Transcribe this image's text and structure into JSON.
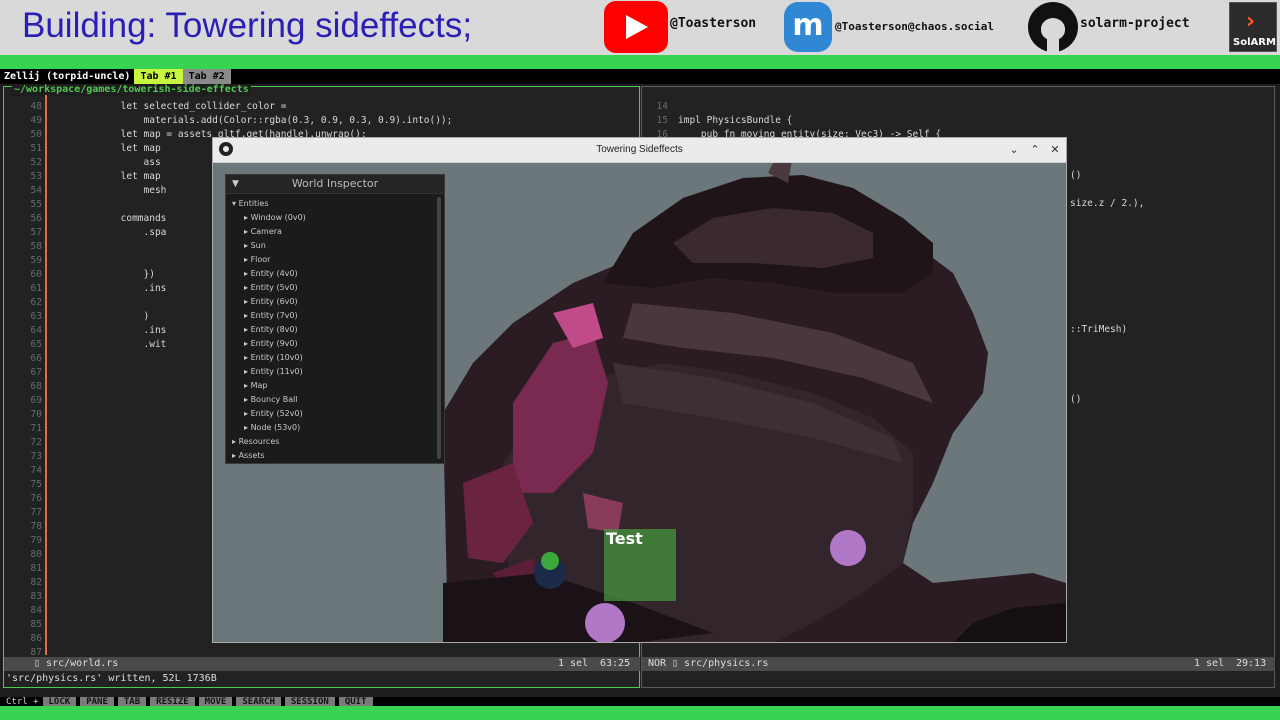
{
  "banner": {
    "title": "Building: Towering sideffects;",
    "youtube": "@Toasterson",
    "mastodon": "@Toasterson@chaos.social",
    "github": "solarm-project",
    "logo_text": "SolARM",
    "colors": {
      "title": "#2a1fb5",
      "youtube": "#ff0000",
      "mastodon": "#3088d4",
      "accent_bar": "#39d353"
    }
  },
  "zellij": {
    "session": "Zellij (torpid-uncle)",
    "tabs": [
      {
        "label": "Tab #1",
        "active": true
      },
      {
        "label": "Tab #2",
        "active": false
      }
    ]
  },
  "left_pane": {
    "title": "~/workspace/games/towerish-side-effects",
    "line_numbers": [
      "48",
      "49",
      "50",
      "51",
      "52",
      "53",
      "54",
      "55",
      "56",
      "57",
      "58",
      "59",
      "60",
      "61",
      "62",
      "63",
      "64",
      "65",
      "66",
      "67",
      "68",
      "69",
      "70",
      "71",
      "72",
      "73",
      "74",
      "75",
      "76",
      "77",
      "78",
      "79",
      "80",
      "81",
      "82",
      "83",
      "84",
      "85",
      "86",
      "87"
    ],
    "lines": [
      "            let selected_collider_color =",
      "                materials.add(Color::rgba(0.3, 0.9, 0.3, 0.9).into());",
      "            let map = assets_gltf.get(handle).unwrap();",
      "            let map",
      "                ass",
      "            let map",
      "                mesh",
      "",
      "            commands",
      "                .spa",
      "",
      "",
      "                })",
      "                .ins",
      "",
      "                )",
      "                .ins",
      "                .wit"
    ],
    "status": {
      "file": "src/world.rs",
      "sel": "1 sel",
      "pos": "63:25"
    }
  },
  "right_pane": {
    "line_numbers": [
      "14",
      "15",
      "16"
    ],
    "lines": [
      "",
      "impl PhysicsBundle {",
      "    pub fn moving_entity(size: Vec3) -> Self {"
    ],
    "fragments": [
      "()",
      "size.z / 2.),",
      "::TriMesh)",
      "()"
    ],
    "status": {
      "mode": "NOR",
      "file": "src/physics.rs",
      "sel": "1 sel",
      "pos": "29:13"
    }
  },
  "command_line": "'src/physics.rs' written, 52L 1736B",
  "hints": [
    "LOCK",
    "PANE",
    "TAB",
    "RESIZE",
    "MOVE",
    "SEARCH",
    "SESSION",
    "QUIT"
  ],
  "game_window": {
    "title": "Towering Sideffects",
    "test_label": "Test",
    "inspector": {
      "title": "World Inspector",
      "sections": [
        {
          "label": "Entities",
          "expanded": true,
          "items": [
            "Window (0v0)",
            "Camera",
            "Sun",
            "Floor",
            "Entity (4v0)",
            "Entity (5v0)",
            "Entity (6v0)",
            "Entity (7v0)",
            "Entity (8v0)",
            "Entity (9v0)",
            "Entity (10v0)",
            "Entity (11v0)",
            "Map",
            "Bouncy Ball",
            "Entity (52v0)",
            "Node (53v0)"
          ]
        },
        {
          "label": "Resources",
          "expanded": false,
          "items": []
        },
        {
          "label": "Assets",
          "expanded": false,
          "items": []
        }
      ]
    }
  }
}
